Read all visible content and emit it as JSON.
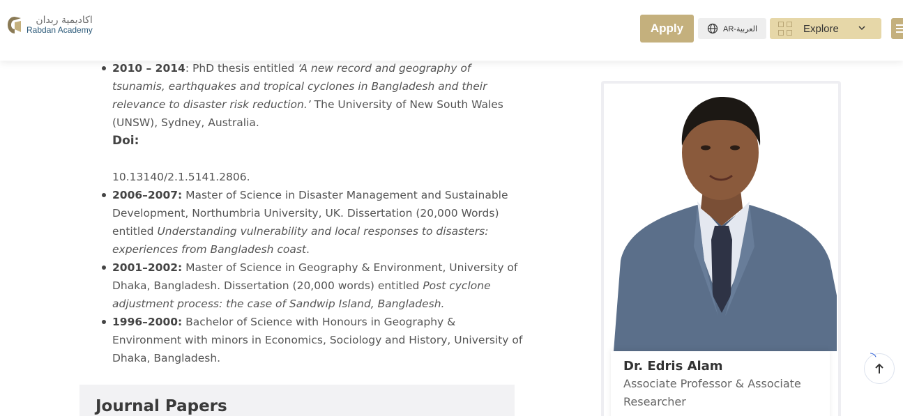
{
  "header": {
    "logo_arabic": "اكاديمية ربدان",
    "logo_english": "Rabdan Academy",
    "apply_label": "Apply",
    "lang_label": "AR-العربية",
    "explore_label": "Explore"
  },
  "education": [
    {
      "years": "2010 – 2014",
      "pre": ": PhD thesis entitled ",
      "italic": "‘A new record and geography of tsunamis, earthquakes and tropical cyclones in Bangladesh and their relevance to disaster risk reduction.’",
      "post": " The University of New South Wales (UNSW), Sydney, Australia.",
      "doi_label": "Doi:",
      "doi_value": "10.13140/2.1.5141.2806."
    },
    {
      "years": "2006–2007:",
      "pre": " Master of Science in Disaster Management and Sustainable Development, Northumbria University, UK. Dissertation (20,000 Words) entitled ",
      "italic": "Understanding vulnerability and local responses to disasters: experiences from Bangladesh coast",
      "post": "."
    },
    {
      "years": "2001–2002:",
      "pre": " Master of Science in Geography & Environment, University of Dhaka, Bangladesh. Dissertation (20,000 words) entitled ",
      "italic": "Post cyclone adjustment process: the case of Sandwip Island, Bangladesh.",
      "post": ""
    },
    {
      "years": "1996–2000:",
      "pre": " Bachelor of Science with Honours in Geography & Environment with minors in Economics, Sociology and History, University of Dhaka, Bangladesh.",
      "italic": "",
      "post": ""
    }
  ],
  "journal_section_title": "Journal Papers",
  "profile": {
    "name": "Dr. Edris Alam",
    "title": "Associate Professor & Associate Researcher"
  },
  "colors": {
    "gold": "#c4b07d",
    "explore_bg": "#e6d7a8",
    "logo_blue": "#2d5b7a"
  },
  "icons": {
    "lang": "globe-icon",
    "explore": "grid-icon",
    "scroll_top": "arrow-up-icon",
    "menu": "hamburger-icon"
  }
}
